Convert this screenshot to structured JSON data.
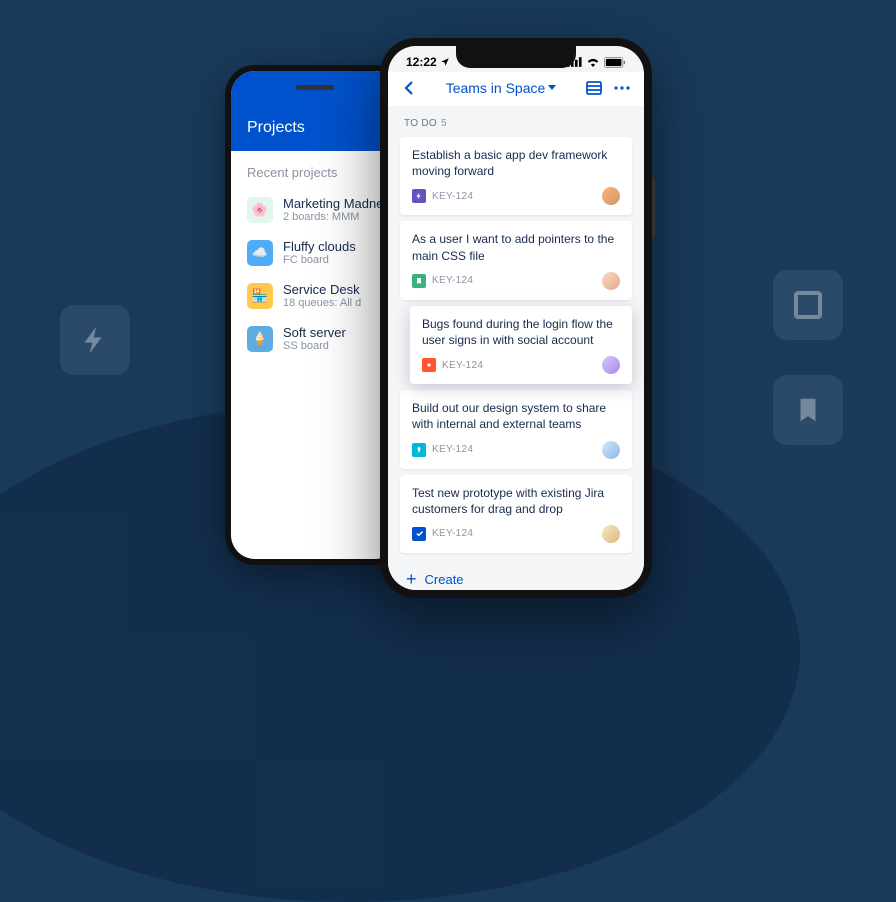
{
  "statusBar": {
    "time": "12:22"
  },
  "backPhone": {
    "header": "Projects",
    "subtitle": "Recent projects",
    "items": [
      {
        "name": "Marketing Madness",
        "sub": "2 boards: MMM",
        "bg": "#e0f7e9"
      },
      {
        "name": "Fluffy clouds",
        "sub": "FC board",
        "bg": "#4dabf7"
      },
      {
        "name": "Service Desk",
        "sub": "18 queues: All d",
        "bg": "#ffc94d"
      },
      {
        "name": "Soft server",
        "sub": "SS board",
        "bg": "#5dade2"
      }
    ]
  },
  "frontPhone": {
    "title": "Teams in Space",
    "section": {
      "label": "TO DO",
      "count": "5"
    },
    "cards": [
      {
        "title": "Establish a basic app dev framework moving forward",
        "key": "KEY-124",
        "iconBg": "#6554c0",
        "icon": "bolt",
        "avatar": "av1"
      },
      {
        "title": "As a user I want to add pointers to the main CSS file",
        "key": "KEY-124",
        "iconBg": "#36b37e",
        "icon": "bookmark",
        "avatar": "av2"
      },
      {
        "title": "Bugs found during the login flow the user signs in with social account",
        "key": "KEY-124",
        "iconBg": "#ff5630",
        "icon": "bug",
        "avatar": "av3",
        "dragging": true
      },
      {
        "title": "Build out our design system to share with internal and external teams",
        "key": "KEY-124",
        "iconBg": "#00b8d9",
        "icon": "gem",
        "avatar": "av4"
      },
      {
        "title": "Test new prototype with existing Jira customers for drag and drop",
        "key": "KEY-124",
        "iconBg": "#0052cc",
        "icon": "check",
        "avatar": "av5"
      }
    ],
    "create": "Create"
  }
}
